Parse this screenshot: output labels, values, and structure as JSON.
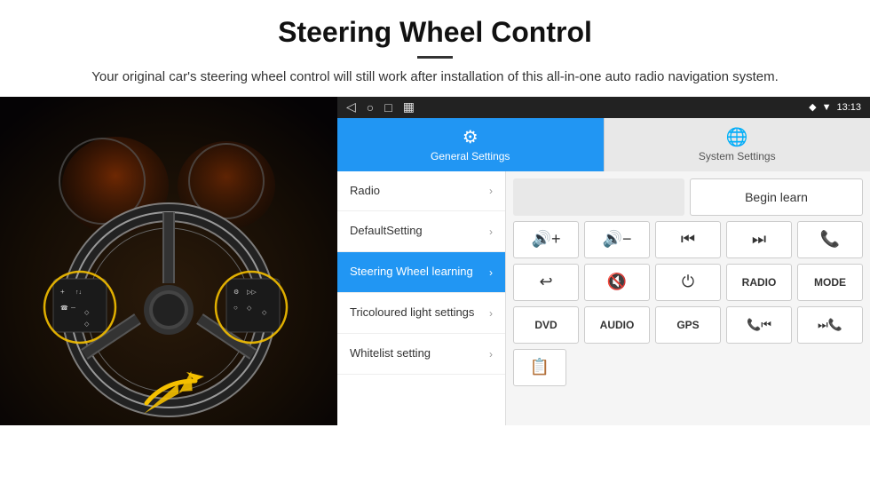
{
  "header": {
    "title": "Steering Wheel Control",
    "subtitle": "Your original car's steering wheel control will still work after installation of this all-in-one auto radio navigation system."
  },
  "status_bar": {
    "time": "13:13",
    "nav_icons": [
      "◁",
      "○",
      "□",
      "▦"
    ],
    "status_icons": [
      "◆",
      "▼",
      "▐▐"
    ]
  },
  "tabs": {
    "general": "General Settings",
    "system": "System Settings"
  },
  "menu": {
    "items": [
      {
        "label": "Radio",
        "active": false
      },
      {
        "label": "DefaultSetting",
        "active": false
      },
      {
        "label": "Steering Wheel learning",
        "active": true
      },
      {
        "label": "Tricoloured light settings",
        "active": false
      },
      {
        "label": "Whitelist setting",
        "active": false
      }
    ]
  },
  "controls": {
    "begin_learn": "Begin learn",
    "buttons_row1": [
      "🔊+",
      "🔊-",
      "⏮",
      "⏭",
      "📞"
    ],
    "buttons_row2": [
      "↩",
      "🔇",
      "⏻",
      "RADIO",
      "MODE"
    ],
    "buttons_row3": [
      "DVD",
      "AUDIO",
      "GPS",
      "📞⏮",
      "⏭📞"
    ]
  }
}
